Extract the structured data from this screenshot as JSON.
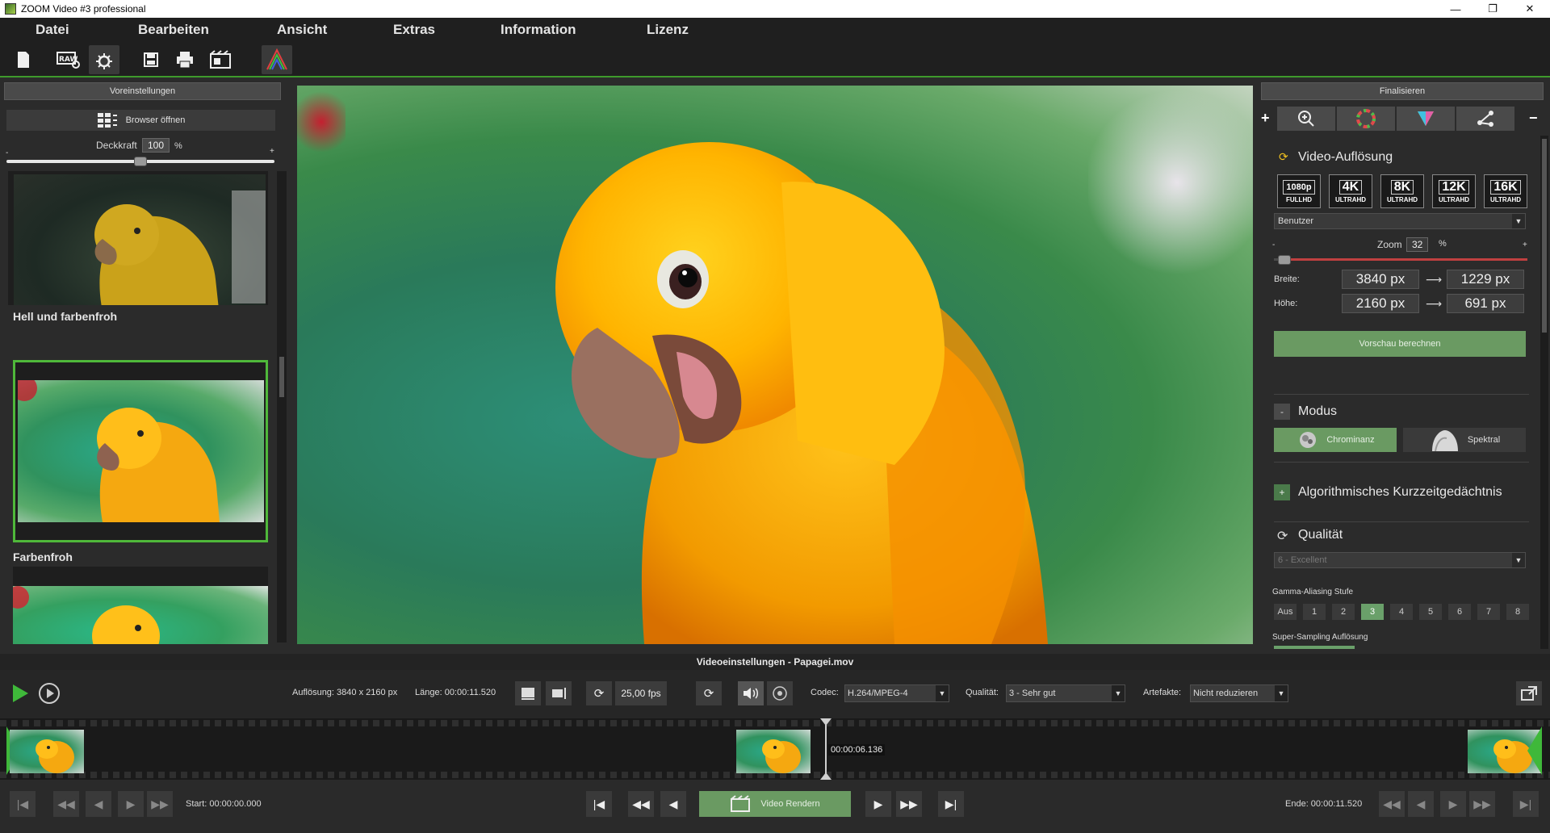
{
  "window": {
    "title": "ZOOM Video #3 professional",
    "minimize": "—",
    "maximize": "❐",
    "close": "✕"
  },
  "menu": [
    "Datei",
    "Bearbeiten",
    "Ansicht",
    "Extras",
    "Information",
    "Lizenz"
  ],
  "toolbar": {
    "icons": [
      "new-document-icon",
      "raw-settings-icon",
      "settings-sparkle-icon",
      "save-icon",
      "print-icon",
      "video-export-icon",
      "histogram-icon"
    ],
    "raw_label": "RAW"
  },
  "left_panel": {
    "header": "Voreinstellungen",
    "browser_button": "Browser öffnen",
    "opacity_label": "Deckkraft",
    "opacity_value": "100",
    "opacity_unit": "%",
    "opacity_min": "-",
    "opacity_max": "+",
    "opacity_fraction": 0.5,
    "presets": [
      {
        "label": ""
      },
      {
        "label": "Hell und farbenfroh"
      },
      {
        "label": "Farbenfroh"
      }
    ]
  },
  "right_panel": {
    "header": "Finalisieren",
    "add_symbol": "+",
    "remove_symbol": "−",
    "tab_icons": [
      "zoom-in-icon",
      "color-wheel-icon",
      "prism-icon",
      "share-nodes-icon"
    ],
    "video_resolution": {
      "title": "Video-Auflösung",
      "buttons": [
        {
          "big": "1080p",
          "small": "FULLHD"
        },
        {
          "big": "4K",
          "small": "ULTRAHD"
        },
        {
          "big": "8K",
          "small": "ULTRAHD"
        },
        {
          "big": "12K",
          "small": "ULTRAHD"
        },
        {
          "big": "16K",
          "small": "ULTRAHD"
        }
      ],
      "preset_dropdown": "Benutzer",
      "zoom_label": "Zoom",
      "zoom_value": "32",
      "zoom_unit": "%",
      "zoom_min": "-",
      "zoom_max": "+",
      "zoom_fraction": 0.04,
      "width_label": "Breite:",
      "height_label": "Höhe:",
      "width_from": "3840 px",
      "width_to": "1229 px",
      "height_from": "2160 px",
      "height_to": "691 px",
      "arrow": "⟶",
      "preview_button": "Vorschau berechnen"
    },
    "mode": {
      "title": "Modus",
      "toggle": "-",
      "options": [
        "Chrominanz",
        "Spektral"
      ]
    },
    "algo": {
      "title": "Algorithmisches Kurzzeitgedächtnis",
      "toggle": "+"
    },
    "quality": {
      "title": "Qualität",
      "dropdown": "6 - Excellent",
      "gamma_label": "Gamma-Aliasing Stufe",
      "gamma_options": [
        "Aus",
        "1",
        "2",
        "3",
        "4",
        "5",
        "6",
        "7",
        "8"
      ],
      "gamma_selected": "3",
      "supersampling_label": "Super-Sampling Auflösung"
    }
  },
  "video": {
    "header": "Videoeinstellungen - Papagei.mov",
    "resolution": "Auflösung: 3840 x 2160 px",
    "length": "Länge: 00:00:11.520",
    "fps": "25,00 fps",
    "codec_label": "Codec:",
    "codec": "H.264/MPEG-4",
    "quality_label": "Qualität:",
    "quality": "3 - Sehr gut",
    "artifacts_label": "Artefakte:",
    "artifacts": "Nicht reduzieren",
    "playhead_time": "00:00:06.136",
    "start": "Start: 00:00:00.000",
    "end": "Ende: 00:00:11.520",
    "render_button": "Video Rendern"
  },
  "colors": {
    "accent": "#3e9a2c",
    "selected_border": "#4fb83a",
    "preview_button": "#6a9a62"
  }
}
